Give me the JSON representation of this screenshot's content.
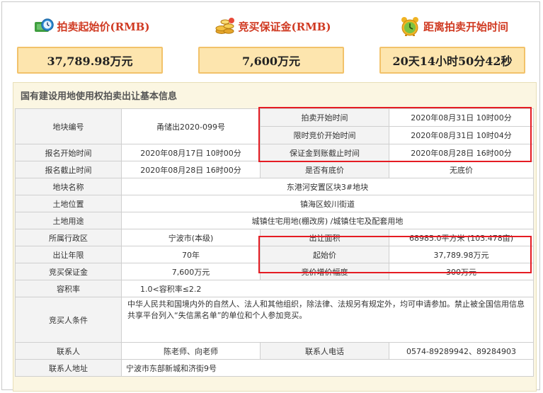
{
  "stats": {
    "price": {
      "label": "拍卖起始价(RMB)",
      "value": "37,789.98万元",
      "icon": "money-clock-icon"
    },
    "deposit": {
      "label": "竞买保证金(RMB)",
      "value": "7,600万元",
      "icon": "coins-icon"
    },
    "countdown": {
      "label": "距离拍卖开始时间",
      "value": "20天14小时50分42秒",
      "icon": "alarm-clock-icon"
    }
  },
  "section": {
    "title": "国有建设用地使用权拍卖出让基本信息"
  },
  "table": {
    "parcel_no_label": "地块编号",
    "parcel_no": "甬储出2020-099号",
    "auction_start_label": "拍卖开始时间",
    "auction_start": "2020年08月31日 10时00分",
    "timed_bid_start_label": "限时竞价开始时间",
    "timed_bid_start": "2020年08月31日 10时04分",
    "reg_start_label": "报名开始时间",
    "reg_start": "2020年08月17日 10时00分",
    "deposit_deadline_label": "保证金到账截止时间",
    "deposit_deadline": "2020年08月28日 16时00分",
    "reg_end_label": "报名截止时间",
    "reg_end": "2020年08月28日 16时00分",
    "reserve_label": "是否有底价",
    "reserve": "无底价",
    "name_label": "地块名称",
    "name": "东港河安置区块3#地块",
    "location_label": "土地位置",
    "location": "镇海区蛟川街道",
    "use_label": "土地用途",
    "use": "城镇住宅用地(棚改房) /城镇住宅及配套用地",
    "district_label": "所属行政区",
    "district": "宁波市(本级)",
    "area_label": "出让面积",
    "area": "68985.0平方米 (103.478亩)",
    "term_label": "出让年限",
    "term": "70年",
    "start_price_label": "起始价",
    "start_price": "37,789.98万元",
    "deposit_label": "竞买保证金",
    "deposit": "7,600万元",
    "increment_label": "竞价增价幅度",
    "increment": "300万元",
    "far_label": "容积率",
    "far": "1.0<容积率≤2.2",
    "bidder_cond_label": "竞买人条件",
    "bidder_cond": "中华人民共和国境内外的自然人、法人和其他组织，除法律、法规另有规定外，均可申请参加。禁止被全国信用信息共享平台列入“失信黑名单”的单位和个人参加竞买。",
    "contact_label": "联系人",
    "contact": "陈老师、向老师",
    "phone_label": "联系人电话",
    "phone": "0574-89289942、89284903",
    "address_label": "联系人地址",
    "address": "宁波市东部新城和济街9号"
  },
  "colors": {
    "label_red": "#d03a22",
    "box_fill": "#fde5ae",
    "box_border": "#f2c26a",
    "highlight": "#e51c23",
    "section_bg": "#fbf6e2"
  }
}
